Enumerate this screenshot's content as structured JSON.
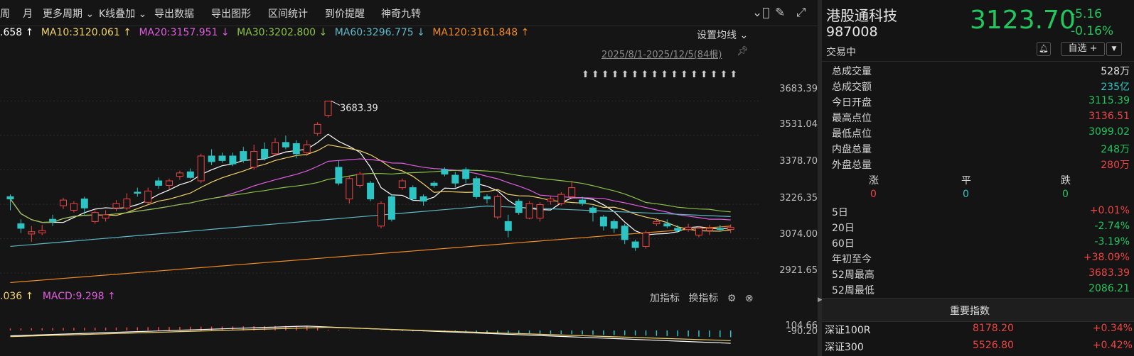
{
  "toolbar": {
    "items": [
      "周",
      "月",
      "更多周期 ⌄",
      "K线叠加 ⌄",
      "导出数据",
      "导出图形",
      "区间统计",
      "到价提醒",
      "神奇九转"
    ],
    "icons": [
      "circle-check-icon",
      "brush-icon",
      "expand-icon"
    ]
  },
  "ma": {
    "ma5_tail": ".658 ↑",
    "ma10": "MA10:3120.061 ↑",
    "ma20": "MA20:3157.951 ↓",
    "ma30": "MA30:3202.800 ↓",
    "ma60": "MA60:3296.775 ↓",
    "ma120": "MA120:3161.848 ↑",
    "colors": {
      "ma5": "#ffffff",
      "ma10": "#f2d36b",
      "ma20": "#e05de0",
      "ma30": "#8bc34a",
      "ma60": "#5fb8c8",
      "ma120": "#f08a24"
    },
    "settings_label": "设置均线 ⌄"
  },
  "range_label": "2025/8/1-2025/12/5(84根)",
  "high_marker": "3683.39",
  "y_axis": [
    "3683.39",
    "3531.04",
    "3378.70",
    "3226.35",
    "3074.00",
    "2921.65"
  ],
  "macd": {
    "head_tail": ".036 ↑",
    "macd_label": "MACD:9.298 ↑",
    "tools": [
      "加指标",
      "换指标"
    ],
    "y_axis": [
      "104.66",
      "-90.20"
    ]
  },
  "quote": {
    "name": "港股通科技",
    "code": "987008",
    "price": "3123.70",
    "change": "-5.16",
    "change_pct": "-0.16%",
    "status": "交易中",
    "watch_label": "自选 +",
    "stats": [
      {
        "label": "总成交量",
        "value": "528万",
        "color": "white"
      },
      {
        "label": "总成交额",
        "value": "235亿",
        "color": "cyan"
      },
      {
        "label": "今日开盘",
        "value": "3115.39",
        "color": "green"
      },
      {
        "label": "最高点位",
        "value": "3136.51",
        "color": "red"
      },
      {
        "label": "最低点位",
        "value": "3099.02",
        "color": "green"
      },
      {
        "label": "内盘总量",
        "value": "248万",
        "color": "green"
      },
      {
        "label": "外盘总量",
        "value": "280万",
        "color": "red"
      }
    ],
    "breadth": {
      "up_label": "涨",
      "flat_label": "平",
      "down_label": "跌",
      "up": "0",
      "flat": "0",
      "down": "0"
    },
    "perf": [
      {
        "label": "5日",
        "value": "+0.01%",
        "color": "red"
      },
      {
        "label": "20日",
        "value": "-2.74%",
        "color": "green"
      },
      {
        "label": "60日",
        "value": "-3.19%",
        "color": "green"
      },
      {
        "label": "年初至今",
        "value": "+38.09%",
        "color": "red"
      },
      {
        "label": "52周最高",
        "value": "3683.39",
        "color": "red"
      },
      {
        "label": "52周最低",
        "value": "2086.21",
        "color": "green"
      }
    ]
  },
  "indices": {
    "title": "重要指数",
    "rows": [
      {
        "name": "深证100R",
        "price": "8178.20",
        "change": "+0.34%"
      },
      {
        "name": "深证300",
        "price": "5526.80",
        "change": "+0.42%"
      }
    ]
  },
  "chart_data": {
    "type": "candlestick",
    "y_range": [
      2850,
      3760
    ],
    "candles": [
      [
        3260,
        3250,
        3270,
        3200
      ],
      [
        3140,
        3120,
        3160,
        3100
      ],
      [
        3095,
        3105,
        3130,
        3060
      ],
      [
        3100,
        3110,
        3135,
        3090
      ],
      [
        3160,
        3150,
        3180,
        3130
      ],
      [
        3220,
        3245,
        3255,
        3205
      ],
      [
        3200,
        3230,
        3240,
        3190
      ],
      [
        3250,
        3210,
        3260,
        3180
      ],
      [
        3150,
        3190,
        3200,
        3140
      ],
      [
        3165,
        3180,
        3200,
        3150
      ],
      [
        3210,
        3230,
        3245,
        3195
      ],
      [
        3210,
        3250,
        3275,
        3200
      ],
      [
        3280,
        3275,
        3300,
        3260
      ],
      [
        3235,
        3285,
        3300,
        3225
      ],
      [
        3330,
        3310,
        3345,
        3295
      ],
      [
        3310,
        3330,
        3340,
        3290
      ],
      [
        3350,
        3365,
        3375,
        3335
      ],
      [
        3370,
        3345,
        3385,
        3340
      ],
      [
        3330,
        3440,
        3450,
        3320
      ],
      [
        3440,
        3415,
        3470,
        3400
      ],
      [
        3440,
        3420,
        3455,
        3410
      ],
      [
        3440,
        3405,
        3455,
        3395
      ],
      [
        3460,
        3420,
        3480,
        3410
      ],
      [
        3390,
        3460,
        3490,
        3380
      ],
      [
        3470,
        3430,
        3500,
        3420
      ],
      [
        3450,
        3500,
        3520,
        3440
      ],
      [
        3500,
        3480,
        3530,
        3470
      ],
      [
        3495,
        3450,
        3510,
        3430
      ],
      [
        3455,
        3490,
        3510,
        3440
      ],
      [
        3540,
        3580,
        3590,
        3530
      ],
      [
        3620,
        3683,
        3683,
        3610
      ],
      [
        3390,
        3320,
        3420,
        3310
      ],
      [
        3250,
        3340,
        3350,
        3230
      ],
      [
        3310,
        3360,
        3370,
        3300
      ],
      [
        3320,
        3250,
        3330,
        3240
      ],
      [
        3130,
        3230,
        3240,
        3120
      ],
      [
        3260,
        3160,
        3270,
        3150
      ],
      [
        3300,
        3330,
        3340,
        3290
      ],
      [
        3300,
        3250,
        3310,
        3240
      ],
      [
        3260,
        3240,
        3270,
        3220
      ],
      [
        3320,
        3310,
        3330,
        3300
      ],
      [
        3380,
        3360,
        3390,
        3350
      ],
      [
        3355,
        3320,
        3370,
        3300
      ],
      [
        3380,
        3340,
        3390,
        3320
      ],
      [
        3340,
        3260,
        3350,
        3250
      ],
      [
        3260,
        3250,
        3270,
        3230
      ],
      [
        3170,
        3260,
        3270,
        3160
      ],
      [
        3150,
        3110,
        3180,
        3080
      ],
      [
        3240,
        3190,
        3250,
        3180
      ],
      [
        3165,
        3230,
        3240,
        3160
      ],
      [
        3165,
        3225,
        3235,
        3150
      ],
      [
        3240,
        3250,
        3265,
        3225
      ],
      [
        3230,
        3270,
        3280,
        3220
      ],
      [
        3260,
        3300,
        3330,
        3250
      ],
      [
        3245,
        3230,
        3260,
        3220
      ],
      [
        3210,
        3190,
        3220,
        3150
      ],
      [
        3170,
        3130,
        3180,
        3110
      ],
      [
        3150,
        3120,
        3160,
        3100
      ],
      [
        3130,
        3070,
        3140,
        3050
      ],
      [
        3060,
        3035,
        3070,
        3020
      ],
      [
        3040,
        3100,
        3110,
        3030
      ],
      [
        3140,
        3150,
        3165,
        3130
      ],
      [
        3140,
        3130,
        3160,
        3120
      ],
      [
        3120,
        3110,
        3135,
        3100
      ],
      [
        3115,
        3125,
        3140,
        3105
      ],
      [
        3090,
        3120,
        3130,
        3080
      ],
      [
        3110,
        3120,
        3135,
        3090
      ],
      [
        3120,
        3115,
        3135,
        3105
      ],
      [
        3115,
        3124,
        3137,
        3099
      ]
    ]
  }
}
